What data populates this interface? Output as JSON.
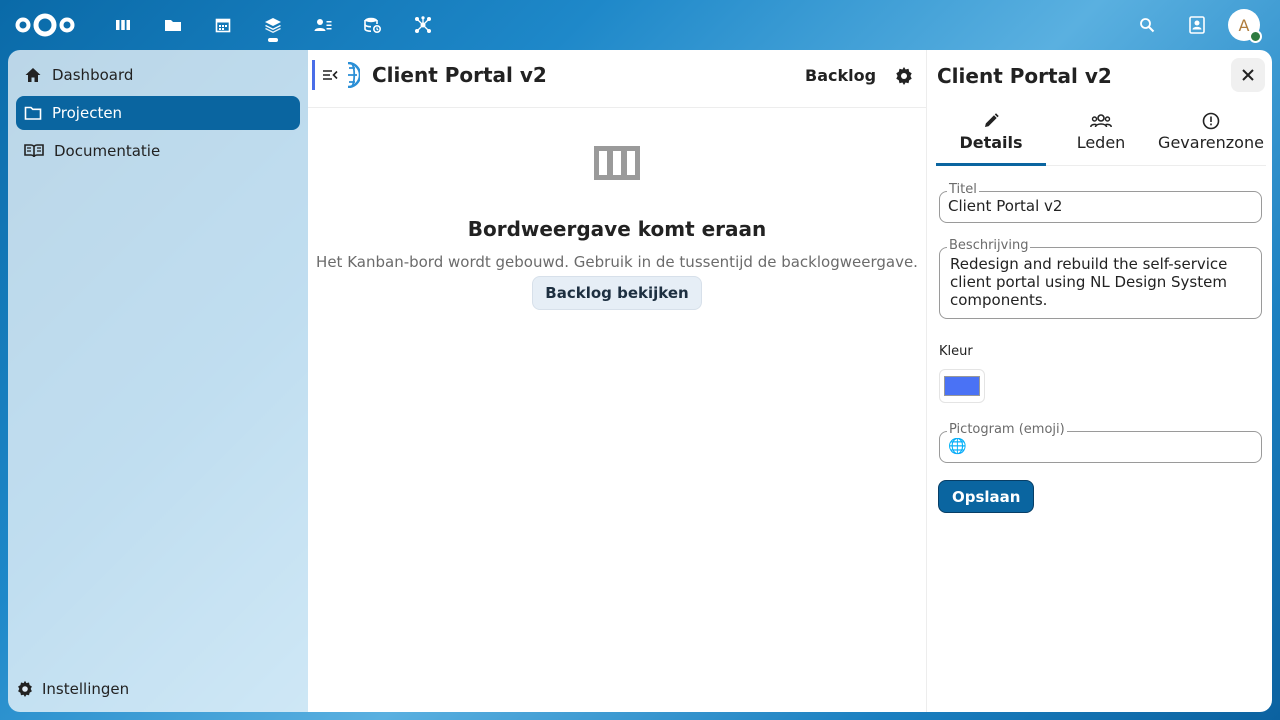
{
  "header": {
    "apps": [
      {
        "name": "deck-icon"
      },
      {
        "name": "files-icon"
      },
      {
        "name": "calendar-icon"
      },
      {
        "name": "projects-icon",
        "active": true
      },
      {
        "name": "contacts-icon"
      },
      {
        "name": "database-icon"
      },
      {
        "name": "network-icon"
      }
    ],
    "avatar_initial": "A"
  },
  "nav": {
    "items": [
      {
        "label": "Dashboard",
        "icon": "home-icon"
      },
      {
        "label": "Projecten",
        "icon": "folder-icon",
        "active": true
      },
      {
        "label": "Documentatie",
        "icon": "book-icon"
      }
    ],
    "settings_label": "Instellingen"
  },
  "main": {
    "title": "Client Portal v2",
    "backlog_label": "Backlog",
    "empty": {
      "title": "Bordweergave komt eraan",
      "description": "Het Kanban-bord wordt gebouwd. Gebruik in de tussentijd de backlogweergave.",
      "button_label": "Backlog bekijken"
    }
  },
  "sidebar": {
    "title": "Client Portal v2",
    "tabs": [
      {
        "label": "Details",
        "active": true
      },
      {
        "label": "Leden"
      },
      {
        "label": "Gevarenzone"
      }
    ],
    "fields": {
      "title_label": "Titel",
      "title_value": "Client Portal v2",
      "description_label": "Beschrijving",
      "description_value": "Redesign and rebuild the self-service client portal using NL Design System components.",
      "color_label": "Kleur",
      "color_value": "#4a72f5",
      "icon_label": "Pictogram (emoji)",
      "icon_value": "🌐"
    },
    "save_label": "Opslaan"
  },
  "colors": {
    "primary": "#0a65a0",
    "accent_border": "#4a6ee8"
  }
}
